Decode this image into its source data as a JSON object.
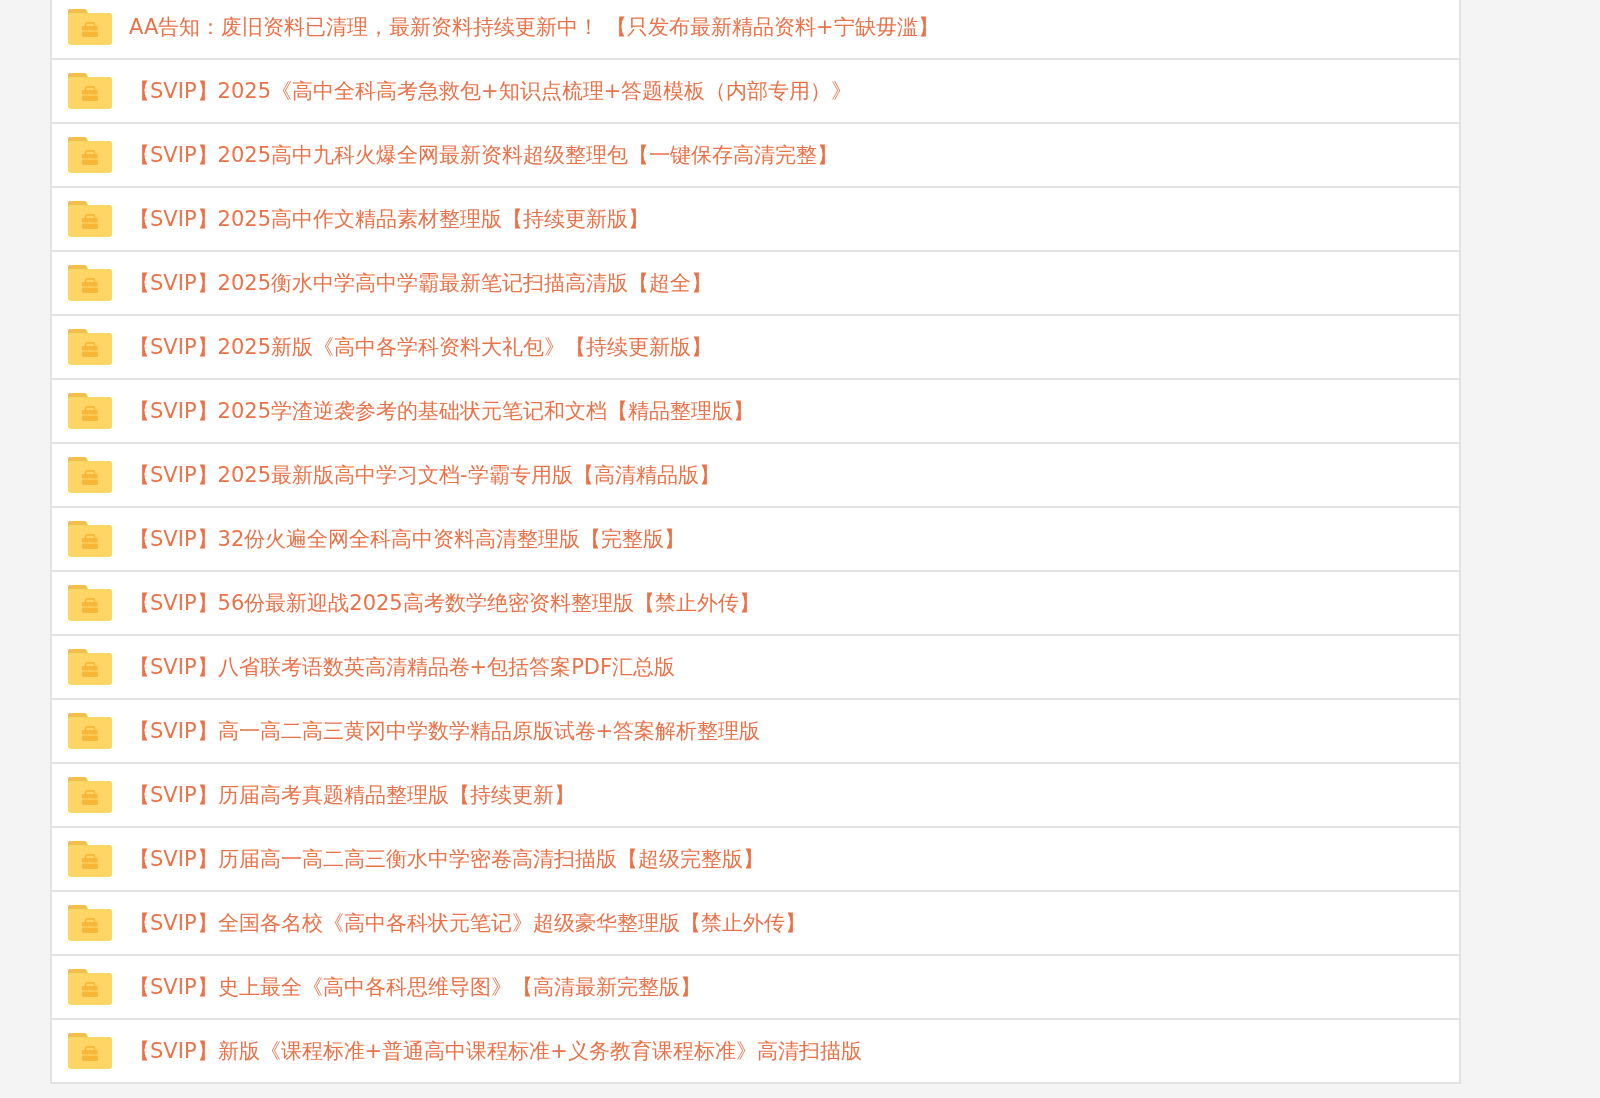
{
  "file_list": {
    "items": [
      {
        "name": "AA告知：废旧资料已清理，最新资料持续更新中！ 【只发布最新精品资料+宁缺毋滥】"
      },
      {
        "name": "【SVIP】2025《高中全科高考急救包+知识点梳理+答题模板（内部专用）》"
      },
      {
        "name": "【SVIP】2025高中九科火爆全网最新资料超级整理包【一键保存高清完整】"
      },
      {
        "name": "【SVIP】2025高中作文精品素材整理版【持续更新版】"
      },
      {
        "name": "【SVIP】2025衡水中学高中学霸最新笔记扫描高清版【超全】"
      },
      {
        "name": "【SVIP】2025新版《高中各学科资料大礼包》【持续更新版】"
      },
      {
        "name": "【SVIP】2025学渣逆袭参考的基础状元笔记和文档【精品整理版】"
      },
      {
        "name": "【SVIP】2025最新版高中学习文档-学霸专用版【高清精品版】"
      },
      {
        "name": "【SVIP】32份火遍全网全科高中资料高清整理版【完整版】"
      },
      {
        "name": "【SVIP】56份最新迎战2025高考数学绝密资料整理版【禁止外传】"
      },
      {
        "name": "【SVIP】八省联考语数英高清精品卷+包括答案PDF汇总版"
      },
      {
        "name": "【SVIP】高一高二高三黄冈中学数学精品原版试卷+答案解析整理版"
      },
      {
        "name": "【SVIP】历届高考真题精品整理版【持续更新】"
      },
      {
        "name": "【SVIP】历届高一高二高三衡水中学密卷高清扫描版【超级完整版】"
      },
      {
        "name": "【SVIP】全国各名校《高中各科状元笔记》超级豪华整理版【禁止外传】"
      },
      {
        "name": "【SVIP】史上最全《高中各科思维导图》【高清最新完整版】"
      },
      {
        "name": "【SVIP】新版《课程标准+普通高中课程标准+义务教育课程标准》高清扫描版"
      }
    ]
  }
}
